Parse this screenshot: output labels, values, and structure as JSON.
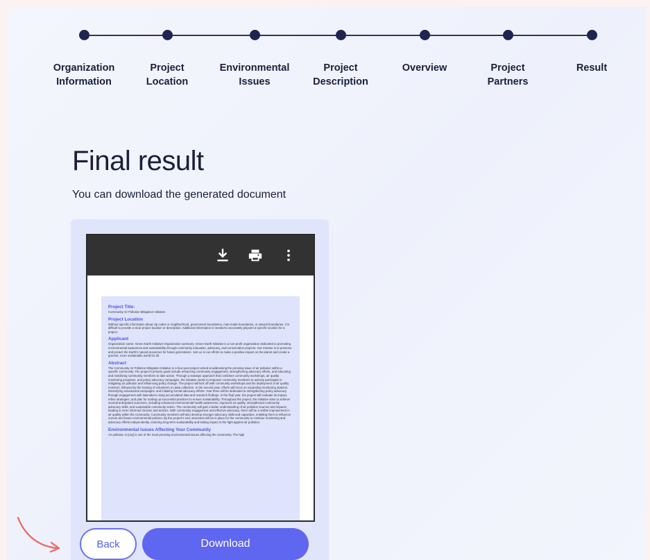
{
  "steps": [
    {
      "label": "Organization\nInformation"
    },
    {
      "label": "Project\nLocation"
    },
    {
      "label": "Environmental\nIssues"
    },
    {
      "label": "Project\nDescription"
    },
    {
      "label": "Overview"
    },
    {
      "label": "Project\nPartners"
    },
    {
      "label": "Result"
    }
  ],
  "page": {
    "title": "Final result",
    "subtitle": "You can download the generated document"
  },
  "viewer": {
    "toolbar_icons": [
      "download-icon",
      "print-icon",
      "more-vert-icon"
    ],
    "document": {
      "project_title_heading": "Project Title:",
      "project_title": "Community Air Pollution Mitigation Initiative",
      "location_heading": "Project Location",
      "location_text": "Without specific information about zip codes or neighborhood, government boundaries, man-made boundaries, or natural boundaries, it is difficult to provide a clear project location or description. Additional information is needed to accurately pinpoint a specific location for a project.",
      "applicant_heading": "Applicant",
      "applicant_text": "Organization name: Green Earth Initiative Organization summary: Green Earth Initiative is a non-profit organization dedicated to promoting environmental awareness and sustainability through community education, advocacy, and conservation projects. Our mission is to preserve and protect the Earth's natural resources for future generations. Join us in our efforts to make a positive impact on the planet and create a greener, more sustainable world for all.",
      "abstract_heading": "Abstract",
      "abstract_text": "The Community Air Pollution Mitigation Initiative is a four-year project aimed at addressing the pressing issue of air pollution within a specific community. The project's primary goals include enhancing community engagement, strengthening advocacy efforts, and educating and mobilizing community members to take action. Through a strategic approach that combines community workshops, air quality monitoring programs, and policy advocacy campaigns, the initiative seeks to empower community members to actively participate in mitigating air pollution and influencing policy change. The project will kick off with community workshops and the deployment of air quality monitors, followed by the training of volunteers on data collection. In the second year, efforts will focus on expanding monitoring stations, intensifying educational campaigns, and initiating formal advocacy efforts. Year three will be dedicated to strengthening policy advocacy through engagement with lawmakers using accumulated data and research findings. In the final year, the project will evaluate its impact, refine strategies, and plan for scaling up successful practices to ensure sustainability. Throughout the project, the initiative aims to achieve several anticipated outcomes, including enhanced environmental health awareness, improved air quality, strengthened community advocacy skills, and sustainable community action. The community will gain a better understanding of air pollution sources and impacts, leading to more informed choices and actions. With community engagement and effective advocacy, there will be a visible improvement in air quality within the community. Community members will also develop stronger advocacy skills and capacities, enabling them to influence current and future environmental policies. By the project's end, structures will be in place for the community to continue monitoring and advocacy efforts independently, ensuring long-term sustainability and lasting impact in the fight against air pollution.",
      "issues_heading": "Environmental Issues Affecting Your Community",
      "issues_text": "Air pollution in [city] is one of the most pressing environmental issues affecting the community. The high"
    }
  },
  "actions": {
    "back_label": "Back",
    "download_label": "Download"
  },
  "colors": {
    "accent": "#5f66f0",
    "step_dot": "#1f2550",
    "annotation_arrow": "#e8706a"
  }
}
